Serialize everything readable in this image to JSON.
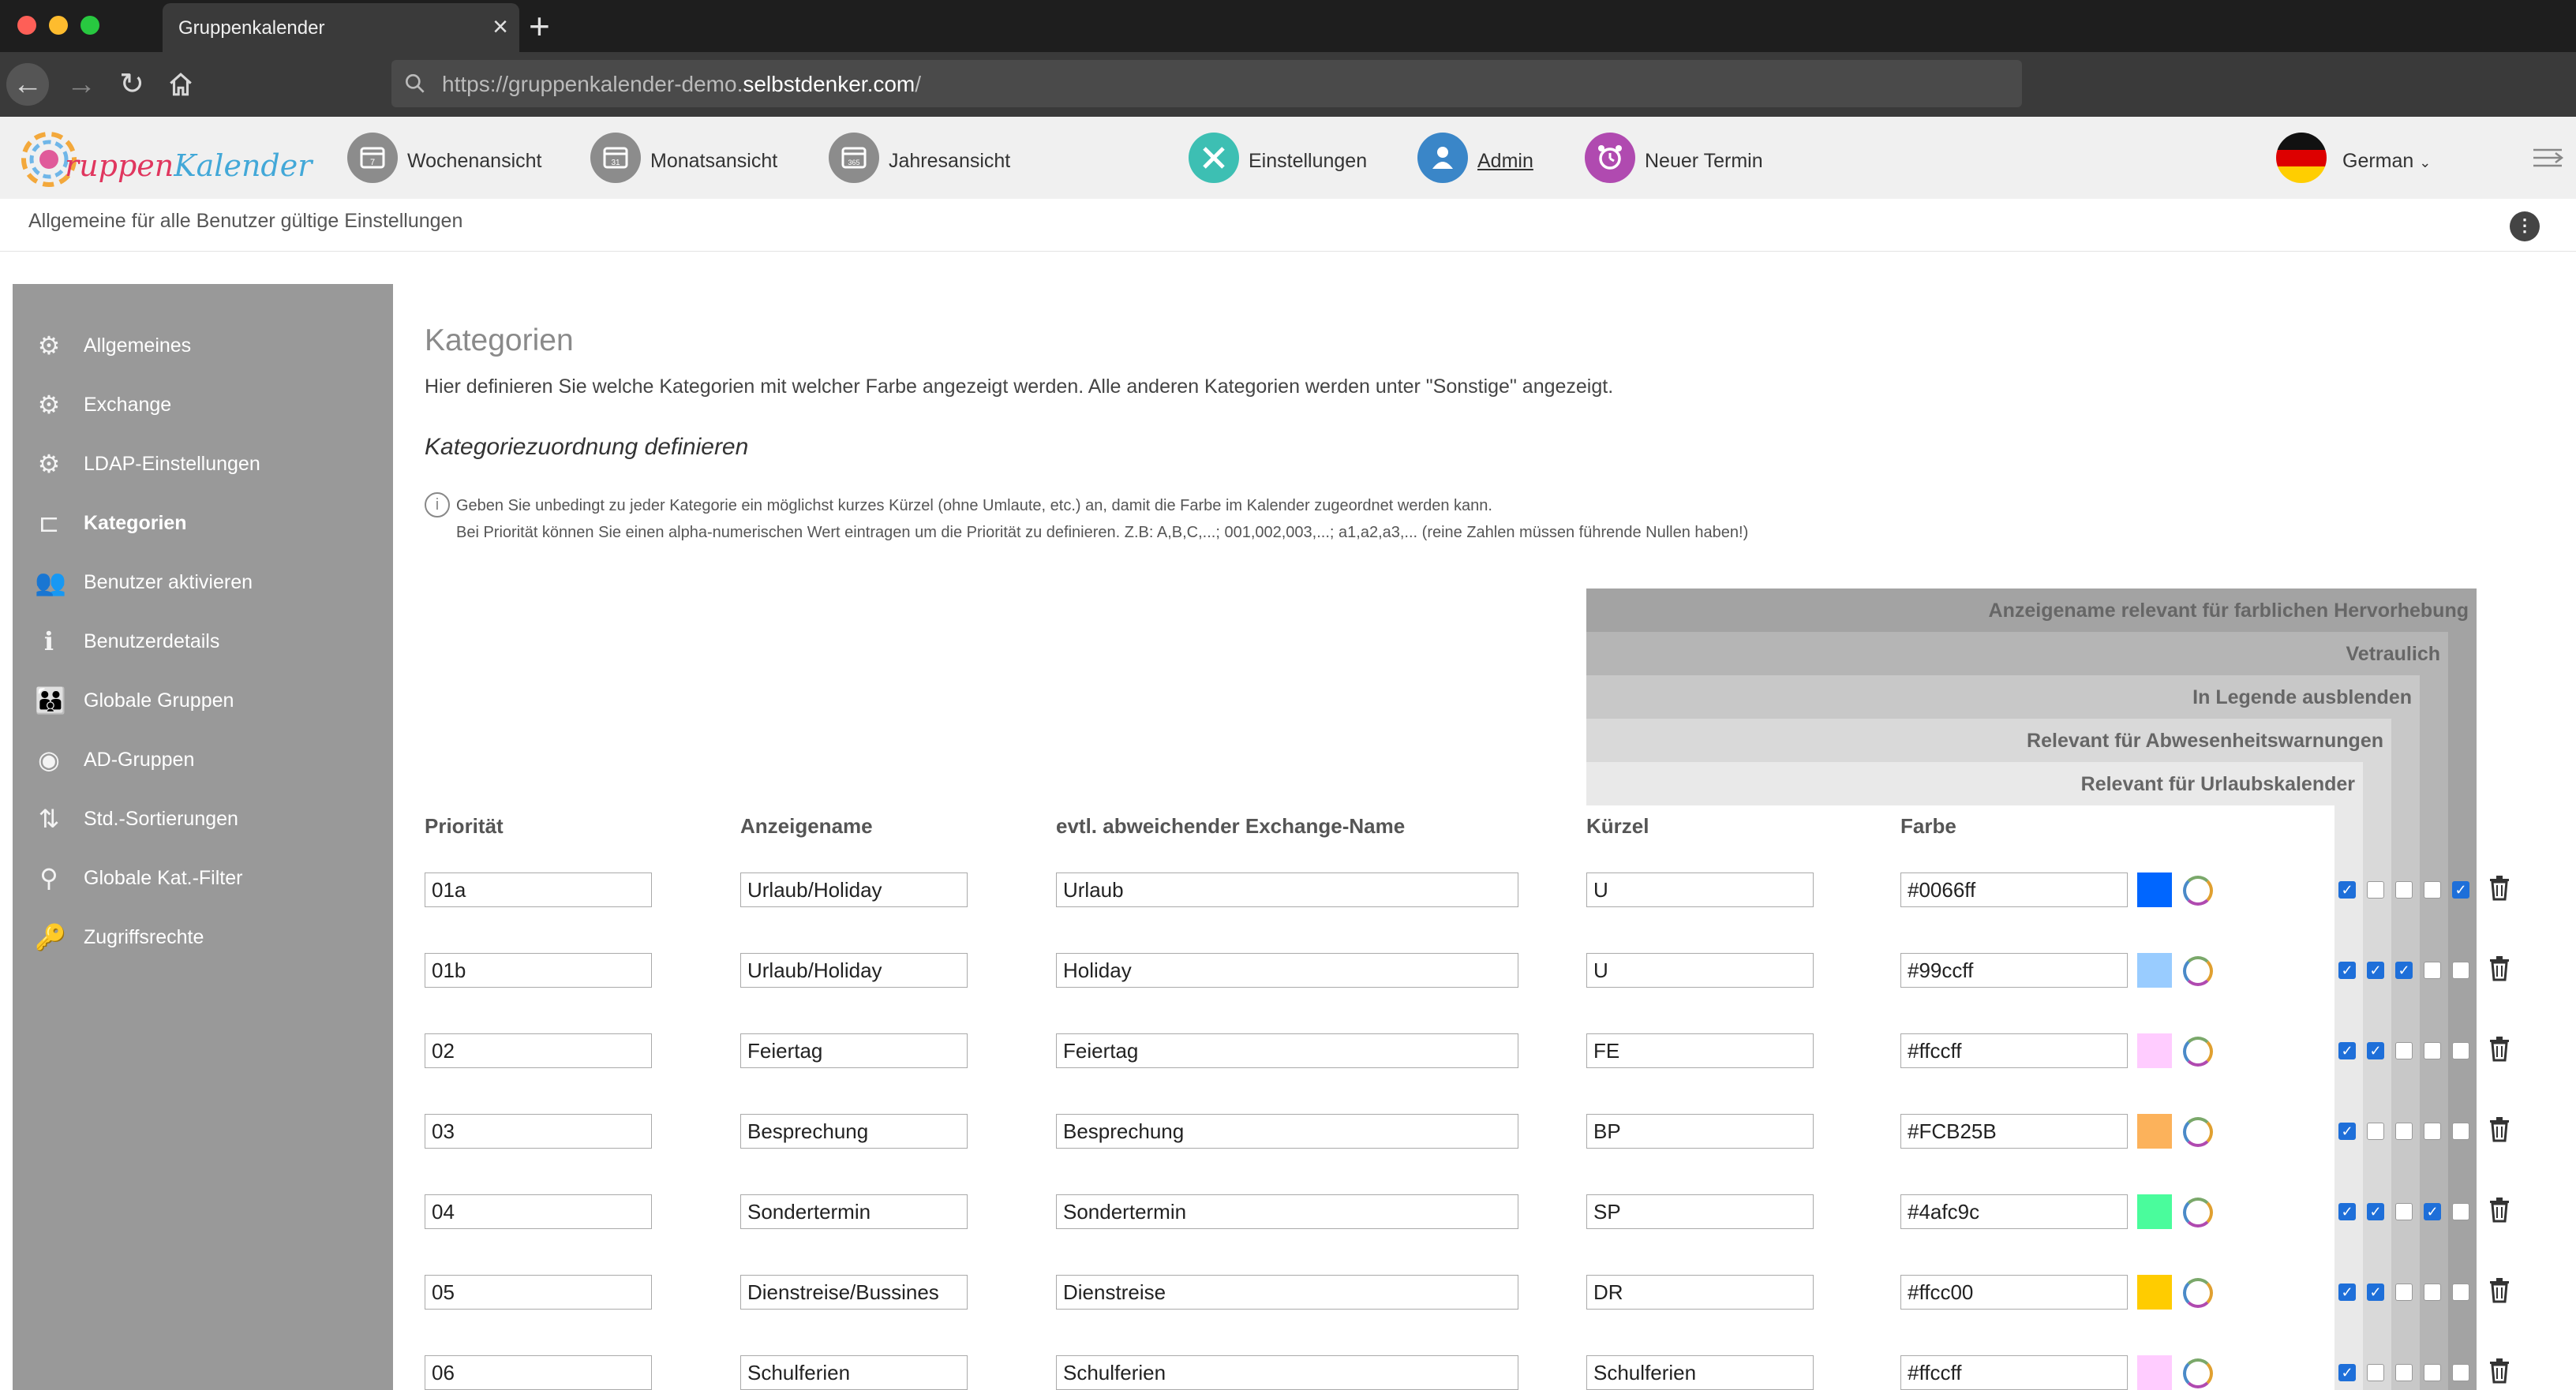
{
  "browser": {
    "tab_title": "Gruppenkalender",
    "url_prefix": "https://gruppenkalender-demo.",
    "url_host": "selbstdenker.com",
    "url_suffix": "/"
  },
  "header": {
    "nav": [
      {
        "label": "Wochenansicht",
        "color": "#8c8c8c"
      },
      {
        "label": "Monatsansicht",
        "color": "#8c8c8c"
      },
      {
        "label": "Jahresansicht",
        "color": "#8c8c8c"
      },
      {
        "label": "Einstellungen",
        "color": "#3dbfb3"
      },
      {
        "label": "Admin",
        "color": "#3a86c8"
      },
      {
        "label": "Neuer Termin",
        "color": "#b04ab0"
      }
    ],
    "language": "German"
  },
  "subheader": "Allgemeine für alle Benutzer gültige Einstellungen",
  "sidebar": {
    "items": [
      {
        "label": "Allgemeines",
        "icon": "gear-icon"
      },
      {
        "label": "Exchange",
        "icon": "gear-icon"
      },
      {
        "label": "LDAP-Einstellungen",
        "icon": "gear-icon"
      },
      {
        "label": "Kategorien",
        "icon": "category-tree-icon",
        "active": true
      },
      {
        "label": "Benutzer aktivieren",
        "icon": "users-icon"
      },
      {
        "label": "Benutzerdetails",
        "icon": "user-details-icon"
      },
      {
        "label": "Globale Gruppen",
        "icon": "group-icon"
      },
      {
        "label": "AD-Gruppen",
        "icon": "ad-group-icon"
      },
      {
        "label": "Std.-Sortierungen",
        "icon": "sort-icon"
      },
      {
        "label": "Globale Kat.-Filter",
        "icon": "filter-icon"
      },
      {
        "label": "Zugriffsrechte",
        "icon": "key-icon"
      }
    ]
  },
  "main": {
    "title": "Kategorien",
    "description": "Hier definieren Sie welche Kategorien mit welcher Farbe angezeigt werden. Alle anderen Kategorien werden unter \"Sonstige\" angezeigt.",
    "section_title": "Kategoriezuordnung definieren",
    "info_line1": "Geben Sie unbedingt zu jeder Kategorie ein möglichst kurzes Kürzel (ohne Umlaute, etc.) an, damit die Farbe im Kalender zugeordnet werden kann.",
    "info_line2": "Bei Priorität können Sie einen alpha-numerischen Wert eintragen um die Priorität zu definieren. Z.B: A,B,C,...; 001,002,003,...; a1,a2,a3,... (reine Zahlen müssen führende Nullen haben!)",
    "bands": [
      "Anzeigename relevant für farblichen Hervorhebung",
      "Vetraulich",
      "In Legende ausblenden",
      "Relevant für Abwesenheitswarnungen",
      "Relevant für Urlaubskalender"
    ],
    "columns": {
      "prioritaet": "Priorität",
      "anzeigename": "Anzeigename",
      "exchange": "evtl. abweichender Exchange-Name",
      "kuerzel": "Kürzel",
      "farbe": "Farbe"
    },
    "rows": [
      {
        "prio": "01a",
        "name": "Urlaub/Holiday",
        "exchange": "Urlaub",
        "kuerzel": "U",
        "farbe": "#0066ff",
        "checks": [
          true,
          false,
          false,
          false,
          true
        ]
      },
      {
        "prio": "01b",
        "name": "Urlaub/Holiday",
        "exchange": "Holiday",
        "kuerzel": "U",
        "farbe": "#99ccff",
        "checks": [
          true,
          true,
          true,
          false,
          false
        ]
      },
      {
        "prio": "02",
        "name": "Feiertag",
        "exchange": "Feiertag",
        "kuerzel": "FE",
        "farbe": "#ffccff",
        "checks": [
          true,
          true,
          false,
          false,
          false
        ]
      },
      {
        "prio": "03",
        "name": "Besprechung",
        "exchange": "Besprechung",
        "kuerzel": "BP",
        "farbe": "#FCB25B",
        "checks": [
          true,
          false,
          false,
          false,
          false
        ]
      },
      {
        "prio": "04",
        "name": "Sondertermin",
        "exchange": "Sondertermin",
        "kuerzel": "SP",
        "farbe": "#4afc9c",
        "checks": [
          true,
          true,
          false,
          true,
          false
        ]
      },
      {
        "prio": "05",
        "name": "Dienstreise/Bussines",
        "exchange": "Dienstreise",
        "kuerzel": "DR",
        "farbe": "#ffcc00",
        "checks": [
          true,
          true,
          false,
          false,
          false
        ]
      },
      {
        "prio": "06",
        "name": "Schulferien",
        "exchange": "Schulferien",
        "kuerzel": "Schulferien",
        "farbe": "#ffccff",
        "checks": [
          true,
          false,
          false,
          false,
          false
        ]
      }
    ]
  }
}
